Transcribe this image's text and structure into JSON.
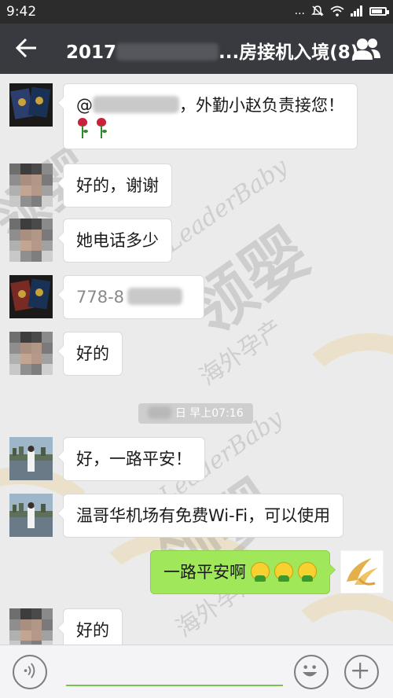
{
  "status_bar": {
    "time": "9:42",
    "dots": "...",
    "battery_level": 0.82
  },
  "header": {
    "title_prefix": "2017",
    "title_suffix": "...房接机入境(8)"
  },
  "messages": [
    {
      "side": "left",
      "text_prefix": "@",
      "text_suffix": "，外勤小赵负责接您！"
    },
    {
      "side": "left",
      "text": "好的，谢谢"
    },
    {
      "side": "left",
      "text": "她电话多少"
    },
    {
      "side": "left",
      "text": "778-8"
    },
    {
      "side": "left",
      "text": "好的"
    },
    {
      "side": "left",
      "text": "好，一路平安！"
    },
    {
      "side": "left",
      "text": "温哥华机场有免费Wi-Fi，可以使用"
    },
    {
      "side": "right",
      "text": "一路平安啊"
    },
    {
      "side": "left",
      "text": "好的"
    }
  ],
  "timestamp": {
    "text": "日 早上07:16"
  },
  "watermarks": {
    "brand_en": "LeaderBaby",
    "brand_cn": "领婴",
    "tagline": "海外孕产"
  },
  "colors": {
    "titlebar": "#393a3f",
    "chat_bg": "#ebebeb",
    "sent_bubble": "#a0e75a",
    "received_bubble": "#ffffff"
  }
}
